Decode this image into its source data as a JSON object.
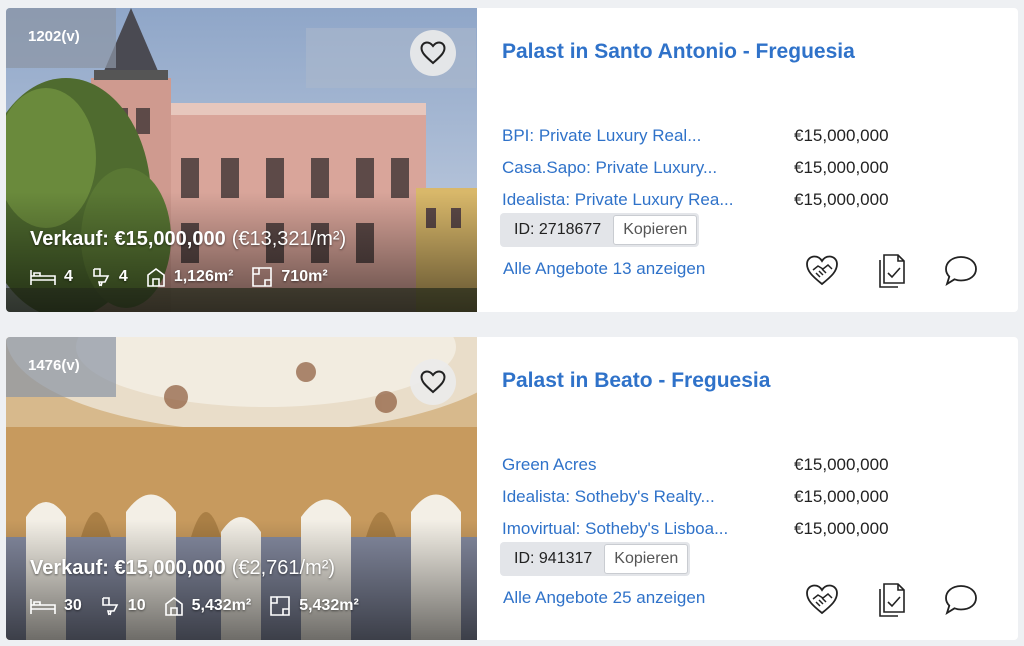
{
  "listings": [
    {
      "ref": "1202(v)",
      "price": "Verkauf: €15,000,000",
      "price_per_m2": "(€13,321/m²)",
      "beds": "4",
      "baths": "4",
      "area": "1,126m²",
      "plot": "710m²",
      "title": "Palast in Santo Antonio - Freguesia",
      "sources": [
        {
          "name": "BPI: Private Luxury Real...",
          "price": "€15,000,000"
        },
        {
          "name": "Casa.Sapo: Private Luxury...",
          "price": "€15,000,000"
        },
        {
          "name": "Idealista: Private Luxury Rea...",
          "price": "€15,000,000"
        }
      ],
      "id_text": "ID: 2718677",
      "copy_label": "Kopieren",
      "all_offers": "Alle Angebote 13 anzeigen"
    },
    {
      "ref": "1476(v)",
      "price": "Verkauf: €15,000,000",
      "price_per_m2": "(€2,761/m²)",
      "beds": "30",
      "baths": "10",
      "area": "5,432m²",
      "plot": "5,432m²",
      "title": "Palast in Beato - Freguesia",
      "sources": [
        {
          "name": "Green Acres",
          "price": "€15,000,000"
        },
        {
          "name": "Idealista: Sotheby's Realty...",
          "price": "€15,000,000"
        },
        {
          "name": "Imovirtual: Sotheby's Lisboa...",
          "price": "€15,000,000"
        }
      ],
      "id_text": "ID: 941317",
      "copy_label": "Kopieren",
      "all_offers": "Alle Angebote 25 anzeigen"
    }
  ],
  "icons": [
    "bed-icon",
    "bath-icon",
    "house-area-icon",
    "plot-area-icon",
    "heart-icon",
    "handshake-icon",
    "document-check-icon",
    "chat-bubble-icon"
  ],
  "colors": {
    "link": "#2f72c9",
    "badge": "#8c96a5"
  }
}
